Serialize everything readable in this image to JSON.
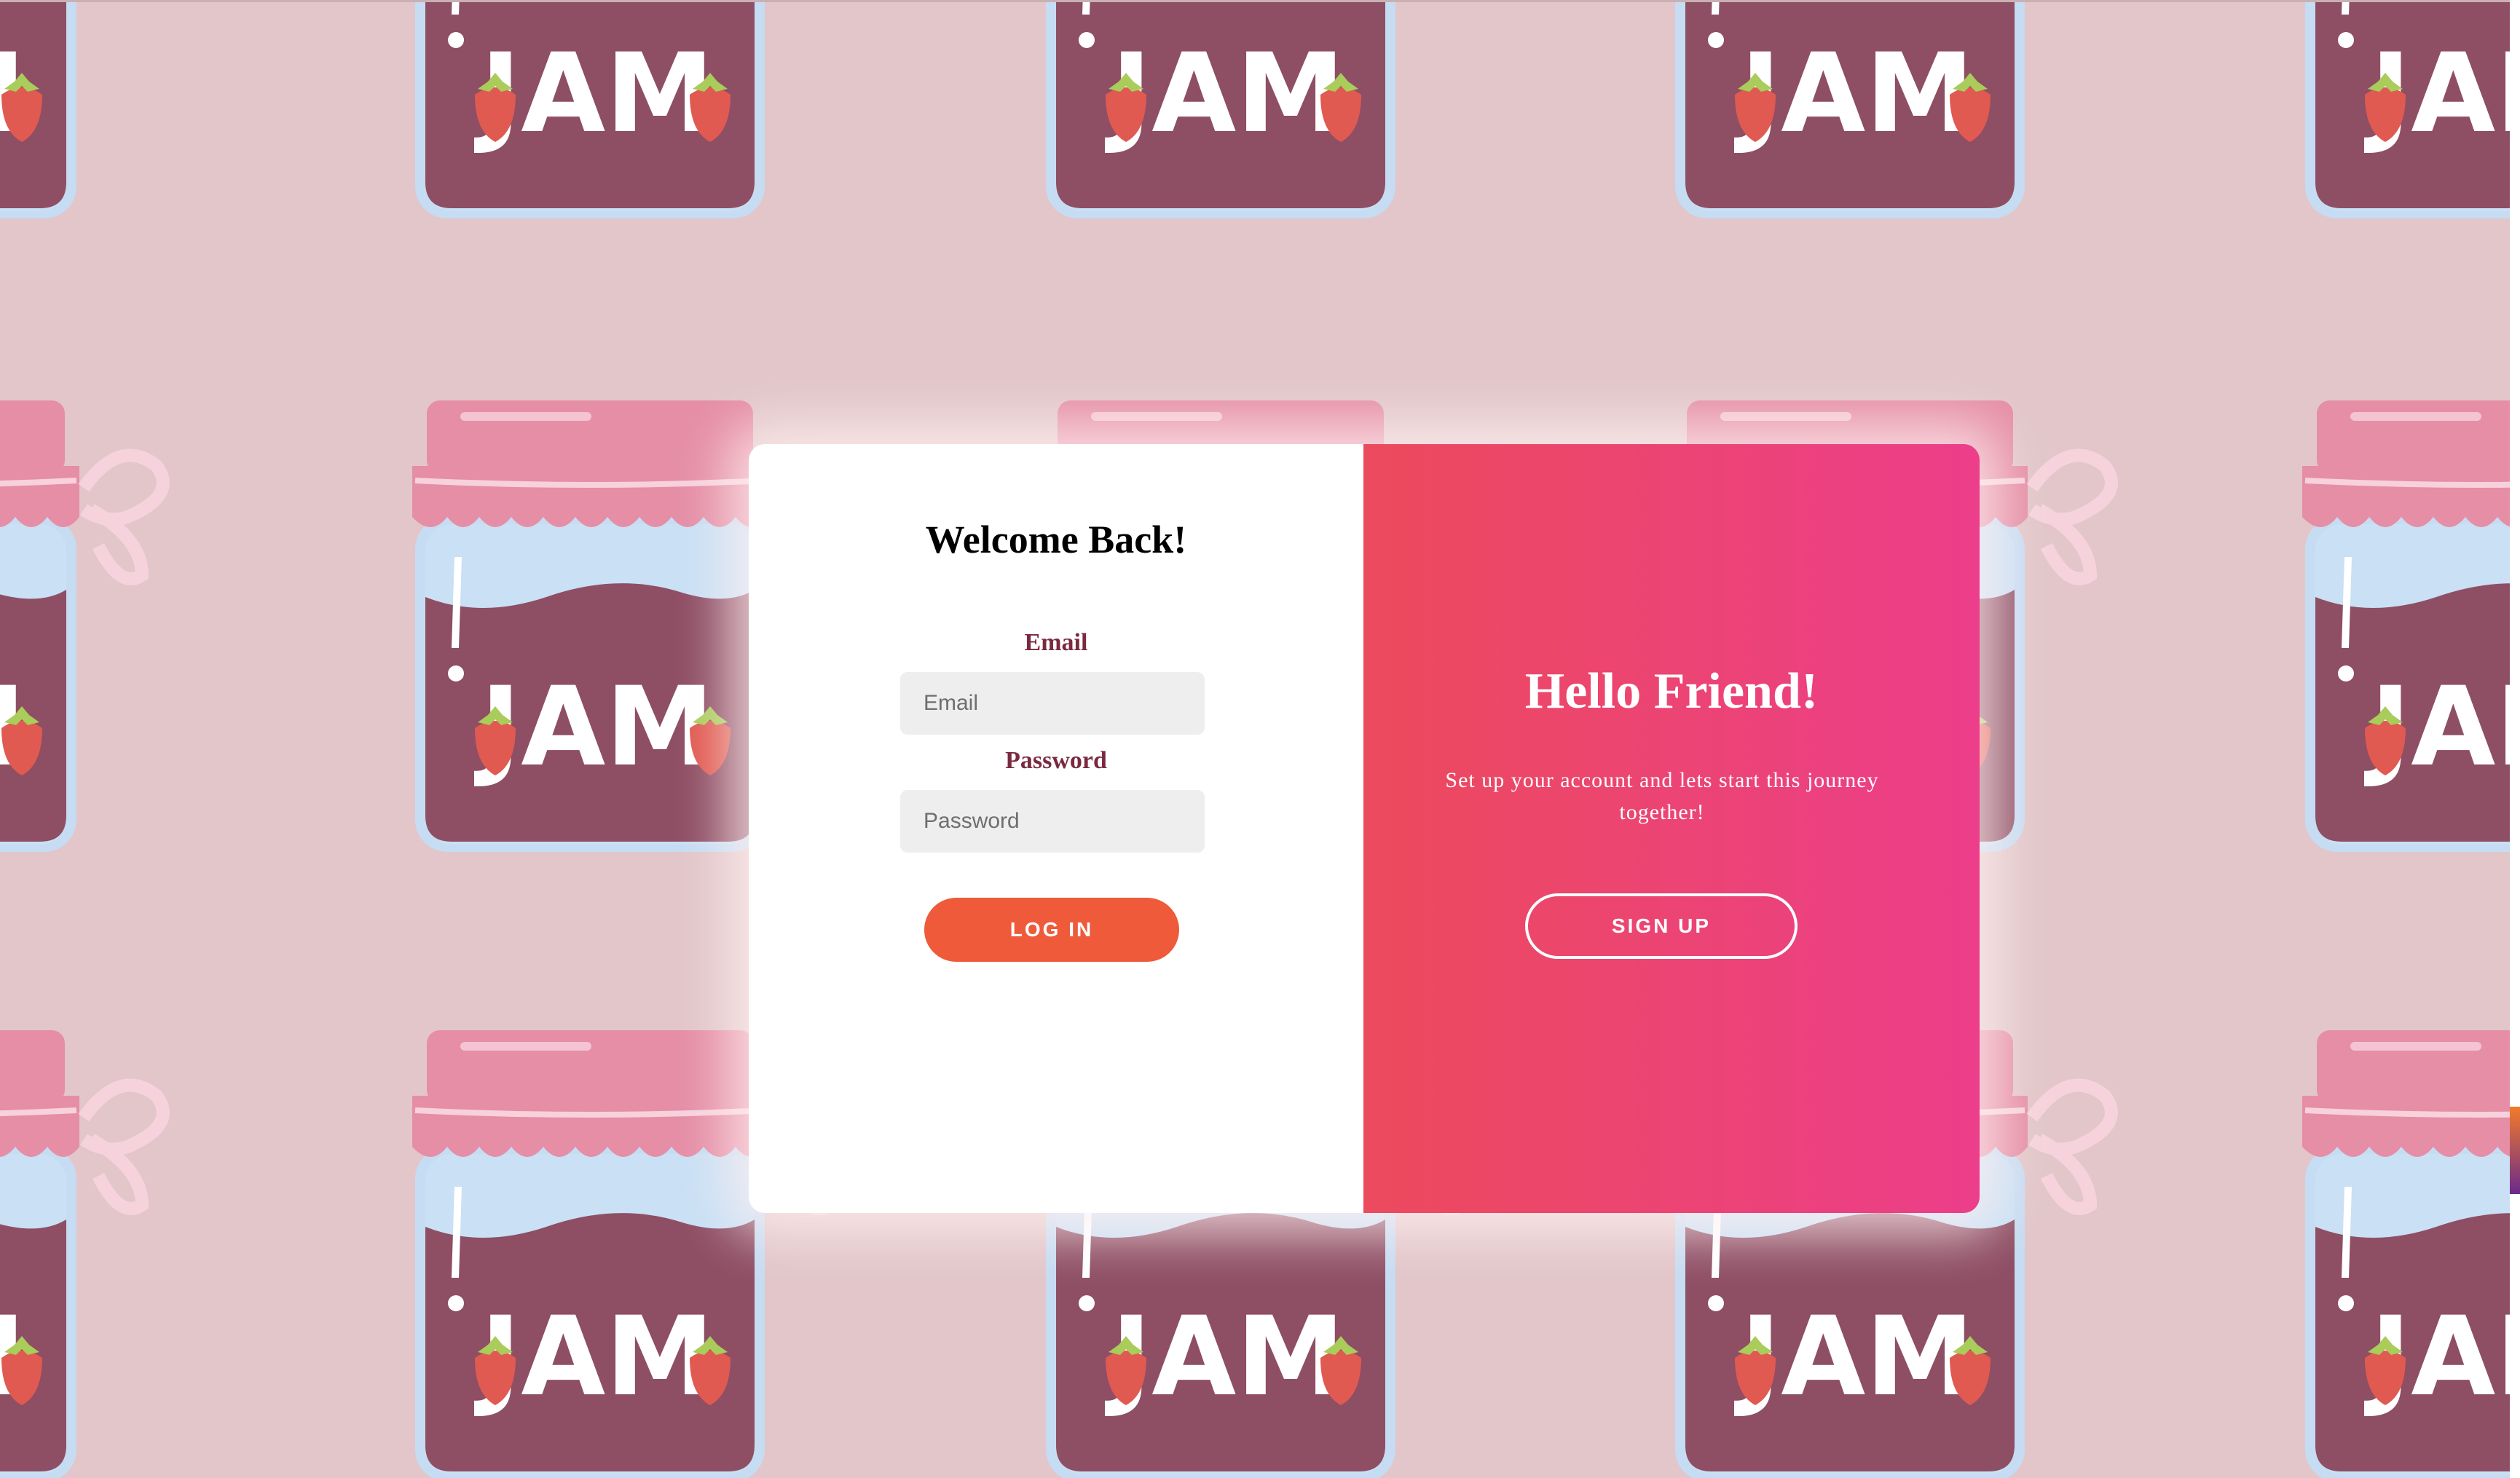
{
  "background": {
    "jar_label": "JAM",
    "colors": {
      "base": "#e2c6c9",
      "jar_body": "#8e4e64",
      "jar_rim": "#c6dcf2",
      "lid": "#e58ea6",
      "strawberry": "#e05a52",
      "leaf": "#a9cc5a"
    }
  },
  "login": {
    "title": "Welcome Back!",
    "email_label": "Email",
    "email_placeholder": "Email",
    "email_value": "",
    "password_label": "Password",
    "password_placeholder": "Password",
    "password_value": "",
    "button_label": "LOG IN",
    "button_color": "#ee5a3a",
    "label_color": "#7a2a40"
  },
  "signup": {
    "title": "Hello Friend!",
    "subtitle": "Set up your account and lets start this journey together!",
    "button_label": "SIGN UP",
    "gradient": [
      "#ec4a5d",
      "#ec3e8a"
    ]
  }
}
